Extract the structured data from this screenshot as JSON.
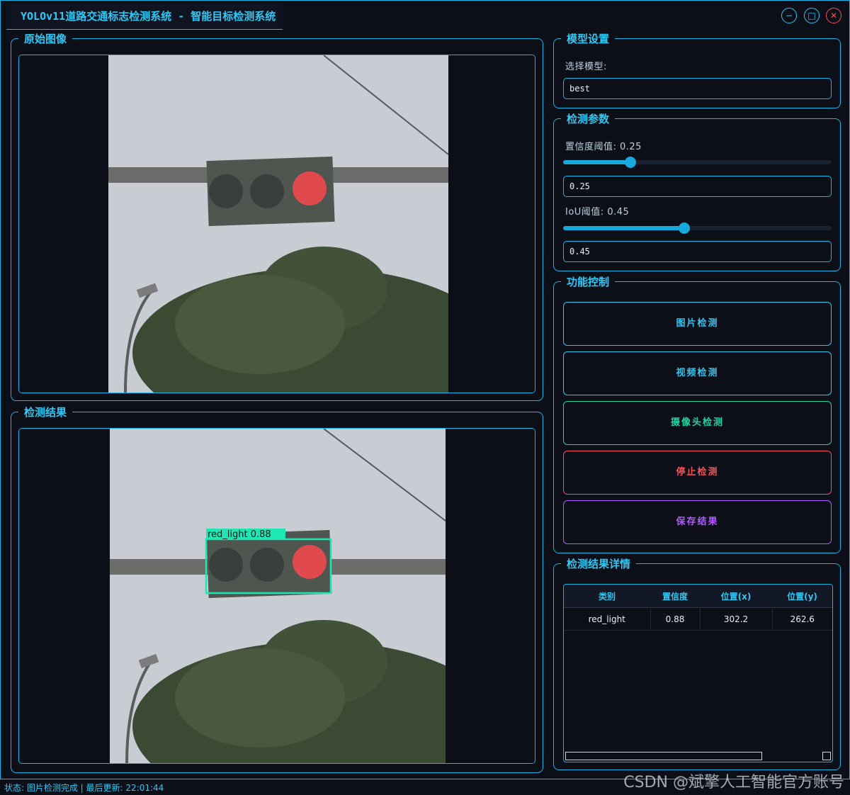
{
  "window": {
    "title": "YOLOv11道路交通标志检测系统 - 智能目标检测系统",
    "min_icon": "minimize-icon",
    "max_icon": "maximize-icon",
    "close_icon": "close-icon"
  },
  "original_panel": {
    "title": "原始图像"
  },
  "result_panel": {
    "title": "检测结果",
    "detection_label": "red_light  0.88"
  },
  "model_settings": {
    "title": "模型设置",
    "select_label": "选择模型:",
    "selected_model": "best"
  },
  "detect_params": {
    "title": "检测参数",
    "conf_label": "置信度阈值: 0.25",
    "conf_value": "0.25",
    "conf_level": 0.25,
    "iou_label": "IoU阈值: 0.45",
    "iou_value": "0.45",
    "iou_level": 0.45
  },
  "function_control": {
    "title": "功能控制",
    "buttons": [
      {
        "label": "图片检测",
        "color": "#2ec8f5"
      },
      {
        "label": "视频检测",
        "color": "#2ec8f5"
      },
      {
        "label": "摄像头检测",
        "color": "#22d3a0"
      },
      {
        "label": "停止检测",
        "color": "#ff4d5a"
      },
      {
        "label": "保存结果",
        "color": "#b05cff"
      }
    ]
  },
  "results_details": {
    "title": "检测结果详情",
    "columns": [
      "类别",
      "置信度",
      "位置(x)",
      "位置(y)"
    ],
    "rows": [
      [
        "red_light",
        "0.88",
        "302.2",
        "262.6"
      ]
    ]
  },
  "status_bar": {
    "text": "状态: 图片检测完成 | 最后更新: 22:01:44"
  },
  "watermark": "CSDN @斌擎人工智能官方账号"
}
